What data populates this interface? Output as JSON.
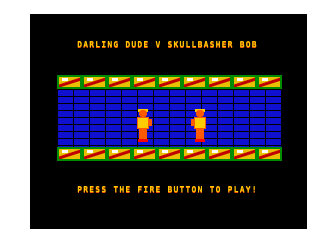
{
  "title": "DARLING DUDE V SKULLBASHER BOB",
  "prompt": "PRESS THE FIRE BUTTON TO PLAY!",
  "colors": {
    "background": "#000000",
    "text": "#ffcc00",
    "text_shadow": "#ff5a00",
    "wall": "#1010d0",
    "border_tile": "#e8c000",
    "border_edge": "#008c00",
    "border_stripe": "#c00000"
  },
  "fighters": [
    {
      "name": "darling-dude"
    },
    {
      "name": "skullbasher-bob"
    }
  ]
}
